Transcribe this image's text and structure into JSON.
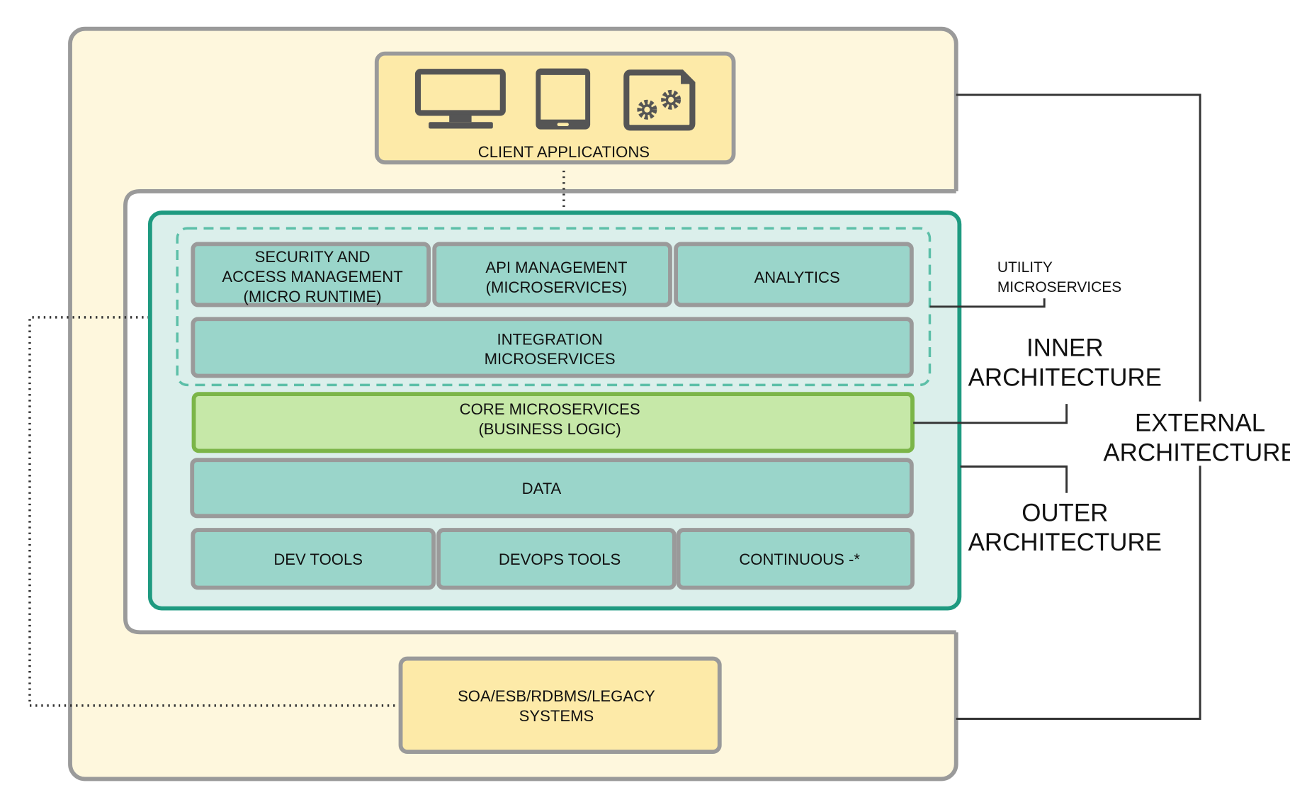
{
  "colors": {
    "cream": "#fef7dd",
    "client_box": "#fdeaa8",
    "teal_fill": "#9ad5ca",
    "teal_border": "#1e9a80",
    "inner_bg": "#dbefeb",
    "core_fill": "#c6e8a8",
    "core_border": "#7bb548",
    "dashed": "#5cbfa8",
    "border_gray": "#9a9a9a",
    "icon_gray": "#555555"
  },
  "client": {
    "label": "CLIENT APPLICATIONS",
    "icons": [
      "monitor-icon",
      "tablet-icon",
      "app-gears-icon"
    ]
  },
  "utility": {
    "security": [
      "SECURITY AND",
      "ACCESS MANAGEMENT",
      "(MICRO RUNTIME)"
    ],
    "api": [
      "API MANAGEMENT",
      "(MICROSERVICES)"
    ],
    "analytics": "ANALYTICS",
    "integration": [
      "INTEGRATION",
      "MICROSERVICES"
    ]
  },
  "core": [
    "CORE MICROSERVICES",
    "(BUSINESS LOGIC)"
  ],
  "data": "DATA",
  "tools": [
    "DEV TOOLS",
    "DEVOPS TOOLS",
    "CONTINUOUS -*"
  ],
  "legacy": [
    "SOA/ESB/RDBMS/LEGACY",
    "SYSTEMS"
  ],
  "annotations": {
    "utility": [
      "UTILITY",
      "MICROSERVICES"
    ],
    "inner": [
      "INNER",
      "ARCHITECTURE"
    ],
    "outer": [
      "OUTER",
      "ARCHITECTURE"
    ],
    "external": [
      "EXTERNAL",
      "ARCHITECTURE"
    ]
  }
}
